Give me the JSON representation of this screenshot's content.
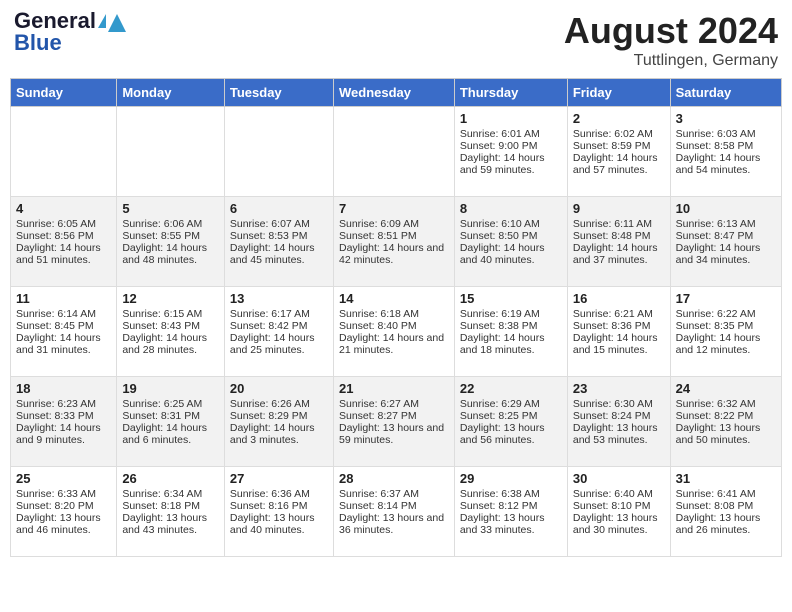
{
  "header": {
    "logo_general": "General",
    "logo_blue": "Blue",
    "month_title": "August 2024",
    "location": "Tuttlingen, Germany"
  },
  "days_of_week": [
    "Sunday",
    "Monday",
    "Tuesday",
    "Wednesday",
    "Thursday",
    "Friday",
    "Saturday"
  ],
  "weeks": [
    [
      {
        "day": "",
        "content": ""
      },
      {
        "day": "",
        "content": ""
      },
      {
        "day": "",
        "content": ""
      },
      {
        "day": "",
        "content": ""
      },
      {
        "day": "1",
        "content": "Sunrise: 6:01 AM\nSunset: 9:00 PM\nDaylight: 14 hours and 59 minutes."
      },
      {
        "day": "2",
        "content": "Sunrise: 6:02 AM\nSunset: 8:59 PM\nDaylight: 14 hours and 57 minutes."
      },
      {
        "day": "3",
        "content": "Sunrise: 6:03 AM\nSunset: 8:58 PM\nDaylight: 14 hours and 54 minutes."
      }
    ],
    [
      {
        "day": "4",
        "content": "Sunrise: 6:05 AM\nSunset: 8:56 PM\nDaylight: 14 hours and 51 minutes."
      },
      {
        "day": "5",
        "content": "Sunrise: 6:06 AM\nSunset: 8:55 PM\nDaylight: 14 hours and 48 minutes."
      },
      {
        "day": "6",
        "content": "Sunrise: 6:07 AM\nSunset: 8:53 PM\nDaylight: 14 hours and 45 minutes."
      },
      {
        "day": "7",
        "content": "Sunrise: 6:09 AM\nSunset: 8:51 PM\nDaylight: 14 hours and 42 minutes."
      },
      {
        "day": "8",
        "content": "Sunrise: 6:10 AM\nSunset: 8:50 PM\nDaylight: 14 hours and 40 minutes."
      },
      {
        "day": "9",
        "content": "Sunrise: 6:11 AM\nSunset: 8:48 PM\nDaylight: 14 hours and 37 minutes."
      },
      {
        "day": "10",
        "content": "Sunrise: 6:13 AM\nSunset: 8:47 PM\nDaylight: 14 hours and 34 minutes."
      }
    ],
    [
      {
        "day": "11",
        "content": "Sunrise: 6:14 AM\nSunset: 8:45 PM\nDaylight: 14 hours and 31 minutes."
      },
      {
        "day": "12",
        "content": "Sunrise: 6:15 AM\nSunset: 8:43 PM\nDaylight: 14 hours and 28 minutes."
      },
      {
        "day": "13",
        "content": "Sunrise: 6:17 AM\nSunset: 8:42 PM\nDaylight: 14 hours and 25 minutes."
      },
      {
        "day": "14",
        "content": "Sunrise: 6:18 AM\nSunset: 8:40 PM\nDaylight: 14 hours and 21 minutes."
      },
      {
        "day": "15",
        "content": "Sunrise: 6:19 AM\nSunset: 8:38 PM\nDaylight: 14 hours and 18 minutes."
      },
      {
        "day": "16",
        "content": "Sunrise: 6:21 AM\nSunset: 8:36 PM\nDaylight: 14 hours and 15 minutes."
      },
      {
        "day": "17",
        "content": "Sunrise: 6:22 AM\nSunset: 8:35 PM\nDaylight: 14 hours and 12 minutes."
      }
    ],
    [
      {
        "day": "18",
        "content": "Sunrise: 6:23 AM\nSunset: 8:33 PM\nDaylight: 14 hours and 9 minutes."
      },
      {
        "day": "19",
        "content": "Sunrise: 6:25 AM\nSunset: 8:31 PM\nDaylight: 14 hours and 6 minutes."
      },
      {
        "day": "20",
        "content": "Sunrise: 6:26 AM\nSunset: 8:29 PM\nDaylight: 14 hours and 3 minutes."
      },
      {
        "day": "21",
        "content": "Sunrise: 6:27 AM\nSunset: 8:27 PM\nDaylight: 13 hours and 59 minutes."
      },
      {
        "day": "22",
        "content": "Sunrise: 6:29 AM\nSunset: 8:25 PM\nDaylight: 13 hours and 56 minutes."
      },
      {
        "day": "23",
        "content": "Sunrise: 6:30 AM\nSunset: 8:24 PM\nDaylight: 13 hours and 53 minutes."
      },
      {
        "day": "24",
        "content": "Sunrise: 6:32 AM\nSunset: 8:22 PM\nDaylight: 13 hours and 50 minutes."
      }
    ],
    [
      {
        "day": "25",
        "content": "Sunrise: 6:33 AM\nSunset: 8:20 PM\nDaylight: 13 hours and 46 minutes."
      },
      {
        "day": "26",
        "content": "Sunrise: 6:34 AM\nSunset: 8:18 PM\nDaylight: 13 hours and 43 minutes."
      },
      {
        "day": "27",
        "content": "Sunrise: 6:36 AM\nSunset: 8:16 PM\nDaylight: 13 hours and 40 minutes."
      },
      {
        "day": "28",
        "content": "Sunrise: 6:37 AM\nSunset: 8:14 PM\nDaylight: 13 hours and 36 minutes."
      },
      {
        "day": "29",
        "content": "Sunrise: 6:38 AM\nSunset: 8:12 PM\nDaylight: 13 hours and 33 minutes."
      },
      {
        "day": "30",
        "content": "Sunrise: 6:40 AM\nSunset: 8:10 PM\nDaylight: 13 hours and 30 minutes."
      },
      {
        "day": "31",
        "content": "Sunrise: 6:41 AM\nSunset: 8:08 PM\nDaylight: 13 hours and 26 minutes."
      }
    ]
  ]
}
